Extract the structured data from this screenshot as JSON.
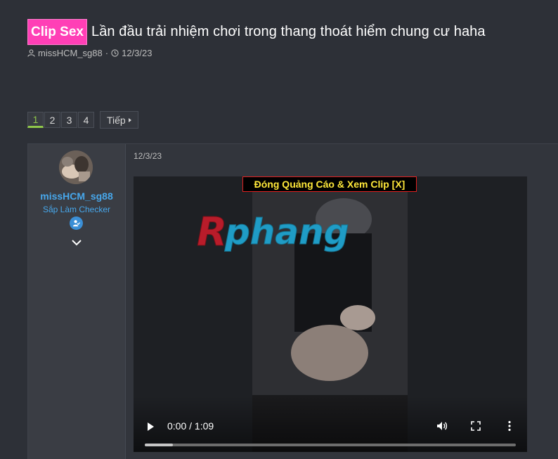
{
  "thread": {
    "prefix": "Clip Sex",
    "title": "Lần đầu trải nhiệm chơi trong thang thoát hiểm chung cư haha",
    "author": "missHCM_sg88",
    "date": "12/3/23"
  },
  "pagination": {
    "pages": [
      "1",
      "2",
      "3",
      "4"
    ],
    "current": "1",
    "next_label": "Tiếp"
  },
  "post": {
    "date": "12/3/23",
    "user": {
      "name": "missHCM_sg88",
      "title": "Sắp Làm Checker"
    },
    "video": {
      "ad_label": "Đóng Quảng Cáo & Xem Clip [X]",
      "watermark": "Rphang",
      "time_display": "0:00 / 1:09",
      "buffered_fraction": 0.075
    }
  },
  "colors": {
    "prefix_bg": "#ff3fb6",
    "username": "#47a7eb",
    "current_page": "#8fc64a",
    "ad_text": "#ffe83a",
    "ad_border": "#e02020"
  },
  "icons": [
    "user-icon",
    "clock-icon",
    "verified-badge-icon",
    "chevron-down-icon",
    "play-icon",
    "volume-icon",
    "fullscreen-icon",
    "more-options-icon"
  ]
}
